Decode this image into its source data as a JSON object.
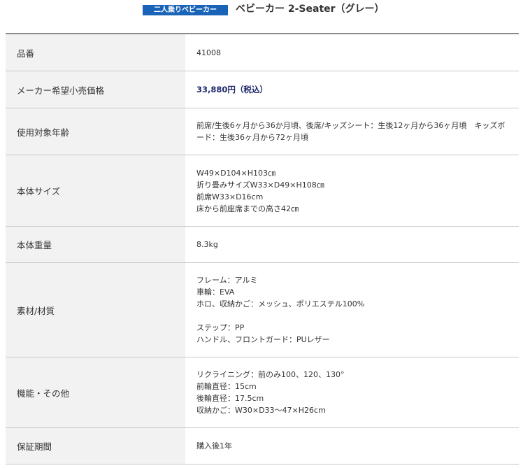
{
  "header": {
    "category_badge": "二人乗りベビーカー",
    "product_title": "ベビーカー 2-Seater（グレー）"
  },
  "specs": [
    {
      "label": "品番",
      "lines": [
        "41008"
      ]
    },
    {
      "label": "メーカー希望小売価格",
      "lines": [
        "33,880円（税込）"
      ]
    },
    {
      "label": "使用対象年齢",
      "lines": [
        "前席/生後6ヶ月から36か月頃、後席/キッズシート：生後12ヶ月から36ヶ月頃　キッズボード：生後36ヶ月から72ヶ月頃"
      ]
    },
    {
      "label": "本体サイズ",
      "lines": [
        "W49×D104×H103㎝",
        "折り畳みサイズW33×D49×H108㎝",
        "前席W33×D16cm",
        "床から前座席までの高さ42㎝"
      ]
    },
    {
      "label": "本体重量",
      "lines": [
        "8.3kg"
      ]
    },
    {
      "label": "素材/材質",
      "lines": [
        "フレーム：アルミ",
        "車輪：EVA",
        "ホロ、収納かご：メッシュ、ポリエステル100%",
        "",
        "ステップ：PP",
        "ハンドル、フロントガード：PUレザー"
      ]
    },
    {
      "label": "機能・その他",
      "lines": [
        "リクライニング：前のみ100、120、130°",
        "前輪直径：15cm",
        "後輪直径：17.5cm",
        "収納かご：W30×D33～47×H26cm"
      ]
    },
    {
      "label": "保証期間",
      "lines": [
        "購入後1年"
      ]
    }
  ]
}
